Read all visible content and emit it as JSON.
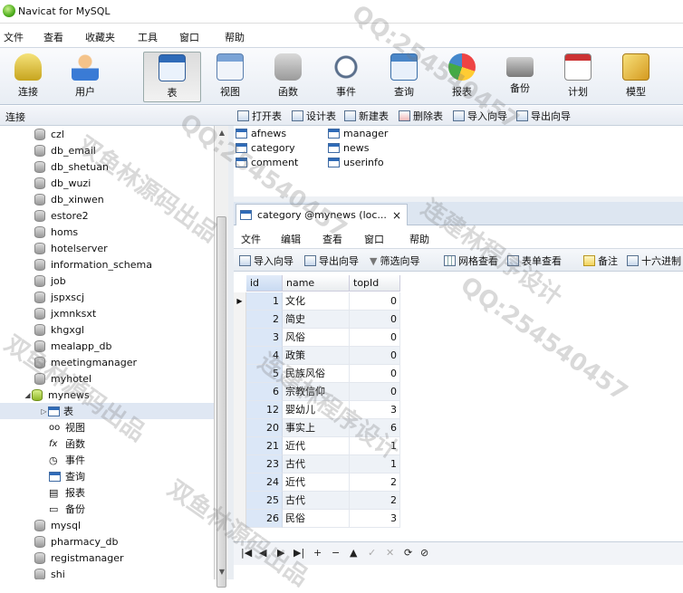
{
  "window": {
    "title": "Navicat for MySQL"
  },
  "menu": [
    "文件",
    "查看",
    "收藏夹",
    "工具",
    "窗口",
    "帮助"
  ],
  "toolbar": [
    {
      "label": "连接",
      "icon": "connection-icon"
    },
    {
      "label": "用户",
      "icon": "user-icon"
    },
    {
      "label": "表",
      "icon": "table-icon"
    },
    {
      "label": "视图",
      "icon": "view-icon"
    },
    {
      "label": "函数",
      "icon": "function-icon"
    },
    {
      "label": "事件",
      "icon": "event-icon"
    },
    {
      "label": "查询",
      "icon": "query-icon"
    },
    {
      "label": "报表",
      "icon": "report-icon"
    },
    {
      "label": "备份",
      "icon": "backup-icon"
    },
    {
      "label": "计划",
      "icon": "schedule-icon"
    },
    {
      "label": "模型",
      "icon": "model-icon"
    }
  ],
  "connection_label": "连接",
  "object_actions": [
    "打开表",
    "设计表",
    "新建表",
    "删除表",
    "导入向导",
    "导出向导"
  ],
  "tree": {
    "databases_before": [
      "czl",
      "db_email",
      "db_shetuan",
      "db_wuzi",
      "db_xinwen",
      "estore2",
      "homs",
      "hotelserver",
      "information_schema",
      "job",
      "jspxscj",
      "jxmnksxt",
      "khgxgl",
      "mealapp_db",
      "meetingmanager",
      "myhotel"
    ],
    "open_db": "mynews",
    "children": [
      "表",
      "视图",
      "函数",
      "事件",
      "查询",
      "报表",
      "备份"
    ],
    "databases_after": [
      "mysql",
      "pharmacy_db",
      "registmanager",
      "shi"
    ]
  },
  "tables": [
    "afnews",
    "category",
    "comment",
    "manager",
    "news",
    "userinfo"
  ],
  "doc_tab": {
    "title": "category @mynews (loc...",
    "close": "×"
  },
  "inner_menu": [
    "文件",
    "编辑",
    "查看",
    "窗口",
    "帮助"
  ],
  "inner_toolbar": [
    "导入向导",
    "导出向导",
    "筛选向导",
    "网格查看",
    "表单查看",
    "备注",
    "十六进制"
  ],
  "grid": {
    "columns": [
      "id",
      "name",
      "topId"
    ],
    "rows": [
      [
        "1",
        "文化",
        "0"
      ],
      [
        "2",
        "简史",
        "0"
      ],
      [
        "3",
        "风俗",
        "0"
      ],
      [
        "4",
        "政策",
        "0"
      ],
      [
        "5",
        "民族风俗",
        "0"
      ],
      [
        "6",
        "宗教信仰",
        "0"
      ],
      [
        "12",
        "婴幼儿",
        "3"
      ],
      [
        "20",
        "事实上",
        "6"
      ],
      [
        "21",
        "近代",
        "1"
      ],
      [
        "23",
        "古代",
        "1"
      ],
      [
        "24",
        "近代",
        "2"
      ],
      [
        "25",
        "古代",
        "2"
      ],
      [
        "26",
        "民俗",
        "3"
      ]
    ]
  },
  "nav": [
    "|◀",
    "◀",
    "▶",
    "▶|",
    "+",
    "−",
    "▲",
    "✓",
    "✕",
    "⟳",
    "⊘"
  ],
  "watermarks": [
    "双鱼林源码出品",
    "QQ:254540457",
    "连建林程序设计",
    "双鱼林源码出品",
    "QQ:254540457",
    "连建林程序设计",
    "QQ:254540457",
    "双鱼林源码出品"
  ]
}
